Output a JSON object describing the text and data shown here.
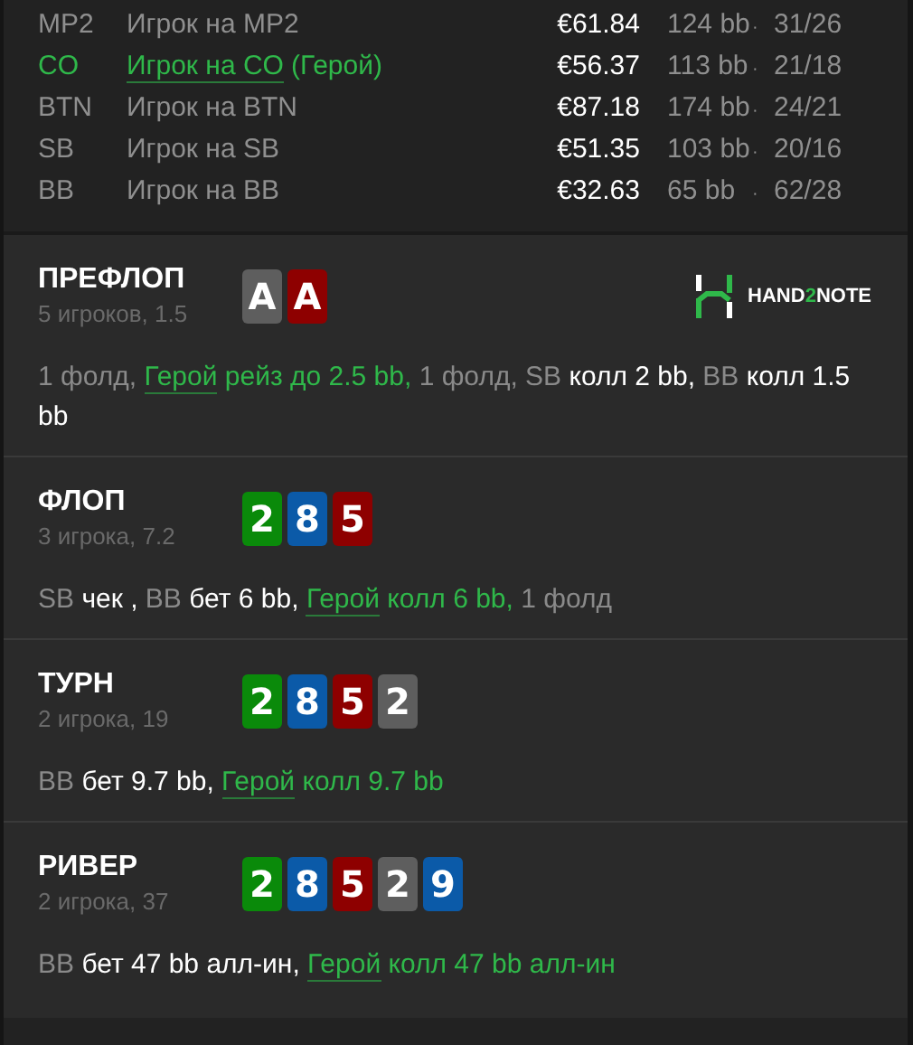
{
  "players": [
    {
      "position": "MP2",
      "name": "Игрок на MP2",
      "hero": false,
      "stack": "€61.84",
      "bb": "124 bb",
      "separator": "·",
      "stats": "31/26"
    },
    {
      "position": "CO",
      "name": "Игрок на CO",
      "hero_tag": "(Герой)",
      "hero": true,
      "stack": "€56.37",
      "bb": "113 bb",
      "separator": "·",
      "stats": "21/18"
    },
    {
      "position": "BTN",
      "name": "Игрок на BTN",
      "hero": false,
      "stack": "€87.18",
      "bb": "174 bb",
      "separator": "·",
      "stats": "24/21"
    },
    {
      "position": "SB",
      "name": "Игрок на SB",
      "hero": false,
      "stack": "€51.35",
      "bb": "103 bb",
      "separator": "·",
      "stats": "20/16"
    },
    {
      "position": "BB",
      "name": "Игрок на BB",
      "hero": false,
      "stack": "€32.63",
      "bb": "65 bb",
      "separator": "·",
      "stats": "62/28"
    }
  ],
  "streets": [
    {
      "title": "ПРЕФЛОП",
      "subtitle": "5 игроков, 1.5",
      "cards": [
        {
          "rank": "A",
          "color": "#5e5e5e"
        },
        {
          "rank": "A",
          "color": "#8e0000"
        }
      ],
      "logo": [
        {
          "text": "HAND",
          "accent": false
        },
        {
          "text": "2",
          "accent": true
        },
        {
          "text": "NOTE",
          "accent": false
        }
      ],
      "actions": [
        {
          "kind": "muted",
          "text": "1 фолд, "
        },
        {
          "kind": "hero-name",
          "text": "Герой"
        },
        {
          "kind": "hero",
          "text": " рейз до 2.5 bb, "
        },
        {
          "kind": "muted",
          "text": "1 фолд, SB "
        },
        {
          "kind": "plain",
          "text": "колл 2 bb, "
        },
        {
          "kind": "muted",
          "text": "BB "
        },
        {
          "kind": "plain",
          "text": "колл 1.5 bb"
        }
      ]
    },
    {
      "title": "ФЛОП",
      "subtitle": "3 игрока, 7.2",
      "cards": [
        {
          "rank": "2",
          "color": "#0a8a0a"
        },
        {
          "rank": "8",
          "color": "#0b5aa8"
        },
        {
          "rank": "5",
          "color": "#8e0000"
        }
      ],
      "actions": [
        {
          "kind": "muted",
          "text": "SB "
        },
        {
          "kind": "plain",
          "text": "чек , "
        },
        {
          "kind": "muted",
          "text": "BB "
        },
        {
          "kind": "plain",
          "text": "бет 6 bb, "
        },
        {
          "kind": "hero-name",
          "text": "Герой"
        },
        {
          "kind": "hero",
          "text": " колл 6 bb, "
        },
        {
          "kind": "muted",
          "text": "1 фолд"
        }
      ]
    },
    {
      "title": "ТУРН",
      "subtitle": "2 игрока, 19",
      "cards": [
        {
          "rank": "2",
          "color": "#0a8a0a"
        },
        {
          "rank": "8",
          "color": "#0b5aa8"
        },
        {
          "rank": "5",
          "color": "#8e0000"
        },
        {
          "rank": "2",
          "color": "#5e5e5e"
        }
      ],
      "actions": [
        {
          "kind": "muted",
          "text": "BB "
        },
        {
          "kind": "plain",
          "text": "бет 9.7 bb, "
        },
        {
          "kind": "hero-name",
          "text": "Герой"
        },
        {
          "kind": "hero",
          "text": " колл 9.7 bb"
        }
      ]
    },
    {
      "title": "РИВЕР",
      "subtitle": "2 игрока, 37",
      "cards": [
        {
          "rank": "2",
          "color": "#0a8a0a"
        },
        {
          "rank": "8",
          "color": "#0b5aa8"
        },
        {
          "rank": "5",
          "color": "#8e0000"
        },
        {
          "rank": "2",
          "color": "#5e5e5e"
        },
        {
          "rank": "9",
          "color": "#0b5aa8"
        }
      ],
      "actions": [
        {
          "kind": "muted",
          "text": "BB "
        },
        {
          "kind": "plain",
          "text": "бет 47 bb алл-ин, "
        },
        {
          "kind": "hero-name",
          "text": "Герой"
        },
        {
          "kind": "hero",
          "text": " колл 47 bb алл-ин"
        }
      ]
    }
  ]
}
